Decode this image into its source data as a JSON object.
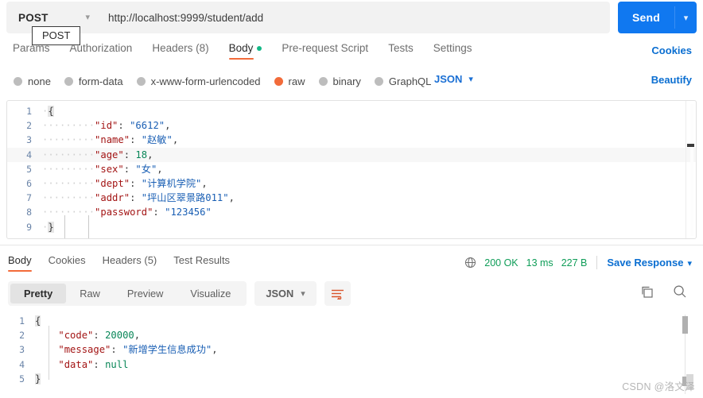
{
  "request": {
    "method": "POST",
    "method_tooltip": "POST",
    "url": "http://localhost:9999/student/add",
    "send_label": "Send",
    "tabs": [
      {
        "label": "Params",
        "active": false
      },
      {
        "label": "Authorization",
        "active": false
      },
      {
        "label": "Headers (8)",
        "active": false
      },
      {
        "label": "Body",
        "active": true,
        "dot": true
      },
      {
        "label": "Pre-request Script",
        "active": false
      },
      {
        "label": "Tests",
        "active": false
      },
      {
        "label": "Settings",
        "active": false
      }
    ],
    "cookies_link": "Cookies",
    "body_types": [
      {
        "label": "none",
        "selected": false
      },
      {
        "label": "form-data",
        "selected": false
      },
      {
        "label": "x-www-form-urlencoded",
        "selected": false
      },
      {
        "label": "raw",
        "selected": true
      },
      {
        "label": "binary",
        "selected": false
      },
      {
        "label": "GraphQL",
        "selected": false
      }
    ],
    "format": "JSON",
    "beautify_label": "Beautify",
    "body_lines": [
      {
        "n": "1",
        "indent": 0,
        "content": "{"
      },
      {
        "n": "2",
        "indent": 4,
        "key": "id",
        "value": "\"6612\"",
        "type": "string",
        "comma": true
      },
      {
        "n": "3",
        "indent": 4,
        "key": "name",
        "value": "\"赵敏\"",
        "type": "string",
        "comma": true
      },
      {
        "n": "4",
        "indent": 4,
        "key": "age",
        "value": "18",
        "type": "number",
        "comma": true,
        "active": true
      },
      {
        "n": "5",
        "indent": 4,
        "key": "sex",
        "value": "\"女\"",
        "type": "string",
        "comma": true
      },
      {
        "n": "6",
        "indent": 4,
        "key": "dept",
        "value": "\"计算机学院\"",
        "type": "string",
        "comma": true
      },
      {
        "n": "7",
        "indent": 4,
        "key": "addr",
        "value": "\"坪山区翠景路011\"",
        "type": "string",
        "comma": true
      },
      {
        "n": "8",
        "indent": 4,
        "key": "password",
        "value": "\"123456\"",
        "type": "string",
        "comma": false
      },
      {
        "n": "9",
        "indent": 0,
        "content": "}"
      }
    ]
  },
  "response": {
    "tabs": [
      {
        "label": "Body",
        "active": true
      },
      {
        "label": "Cookies",
        "active": false
      },
      {
        "label": "Headers (5)",
        "active": false
      },
      {
        "label": "Test Results",
        "active": false
      }
    ],
    "status_code": "200 OK",
    "time": "13 ms",
    "size": "227 B",
    "save_response": "Save Response",
    "views": [
      {
        "label": "Pretty",
        "active": true
      },
      {
        "label": "Raw",
        "active": false
      },
      {
        "label": "Preview",
        "active": false
      },
      {
        "label": "Visualize",
        "active": false
      }
    ],
    "format": "JSON",
    "body_lines": [
      {
        "n": "1",
        "indent": 0,
        "content": "{"
      },
      {
        "n": "2",
        "indent": 4,
        "key": "code",
        "value": "20000",
        "type": "number",
        "comma": true
      },
      {
        "n": "3",
        "indent": 4,
        "key": "message",
        "value": "\"新增学生信息成功\"",
        "type": "string",
        "comma": true
      },
      {
        "n": "4",
        "indent": 4,
        "key": "data",
        "value": "null",
        "type": "null",
        "comma": false
      },
      {
        "n": "5",
        "indent": 0,
        "content": "}"
      }
    ]
  },
  "watermark": "CSDN @洛文泽",
  "colors": {
    "accent_blue": "#1078f0",
    "link_blue": "#0a6ed1",
    "orange": "#f26b3a",
    "green": "#0f9d58",
    "body_dot_green": "#12b886"
  }
}
